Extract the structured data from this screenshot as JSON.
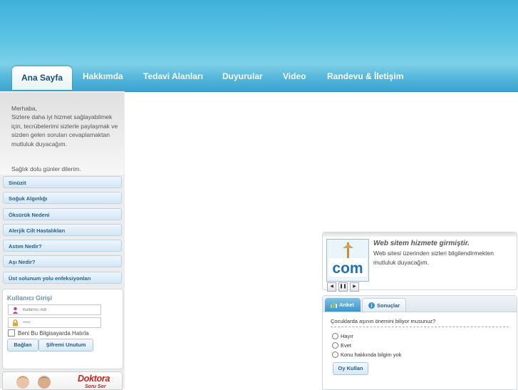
{
  "nav": {
    "items": [
      "Ana Sayfa",
      "Hakkımda",
      "Tedavi Alanları",
      "Duyurular",
      "Video",
      "Randevu & İletişim"
    ],
    "active_index": 0
  },
  "sidebar": {
    "greeting": "Merhaba,\nSizlere daha iyi hizmet sağlayabilmek için, tecrübelerimi sizlerle paylaşmak ve sizden gelen soruları cevaplamaktan mutluluk duyacağım.",
    "wish": "Sağlık dolu günler dilerim.",
    "menu": [
      "Sinüzit",
      "Soğuk Algınlığı",
      "Öksürük Nedeni",
      "Alerjik Cilt Hastalıkları",
      "Astım Nedir?",
      "Aşı Nedir?",
      "Üst solunum yolu enfeksiyonları"
    ]
  },
  "login": {
    "title": "Kullanıcı Girişi",
    "username_placeholder": "Kullanıcı Adı",
    "password_value": "•••••",
    "remember_label": "Beni Bu Bilgisayarda Hatırla",
    "login_button": "Bağlan",
    "forgot_button": "Şifremi Unutum"
  },
  "banner": {
    "title": "Doktora",
    "subtitle": "Soru Sor"
  },
  "news": {
    "thumb_text": "com",
    "title": "Web sitem hizmete girmiştir.",
    "body": "Web sitesi üzerinden sizleri bilgilendirmekten mutluluk duyacağım.",
    "controls": [
      "prev-icon",
      "pause-icon",
      "next-icon"
    ]
  },
  "poll": {
    "tab_poll": "Anket",
    "tab_results": "Sonuçlar",
    "question": "Çocuklarda aşının önemini biliyor musunuz?",
    "options": [
      "Hayır",
      "Evet",
      "Konu hakkında bilgim yok"
    ],
    "vote_button": "Oy Kullan"
  },
  "colors": {
    "header": "#4fb9df",
    "nav_text": "#ffffff",
    "link_blue": "#2a5f89",
    "banner_red": "#c4261d"
  }
}
